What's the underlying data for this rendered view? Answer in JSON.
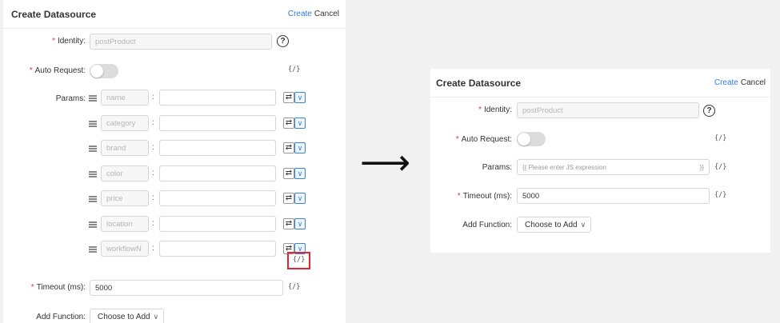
{
  "header": {
    "title": "Create Datasource",
    "create_label": "Create",
    "cancel_label": "Cancel"
  },
  "form": {
    "identity_label": "Identity:",
    "identity_value": "postProduct",
    "auto_request_label": "Auto Request:",
    "params_label": "Params:",
    "timeout_label": "Timeout (ms):",
    "timeout_value": "5000",
    "add_function_label": "Add Function:",
    "add_function_button": "Choose to Add",
    "js_toggle": "{/}",
    "help_icon_text": "?",
    "required_mark": "*",
    "colon": ":"
  },
  "params": [
    {
      "key": "name"
    },
    {
      "key": "category"
    },
    {
      "key": "brand"
    },
    {
      "key": "color"
    },
    {
      "key": "price"
    },
    {
      "key": "location"
    },
    {
      "key": "workflowN"
    }
  ],
  "right_form": {
    "params_placeholder": "{{ Please enter JS expression",
    "params_suffix": "}}"
  },
  "arrow": "⟶",
  "icons": {
    "swap": "⇄",
    "chevron": "∨"
  },
  "colors": {
    "accent": "#2f7bd6",
    "required": "#e23b3b",
    "highlight": "#e0272d"
  }
}
